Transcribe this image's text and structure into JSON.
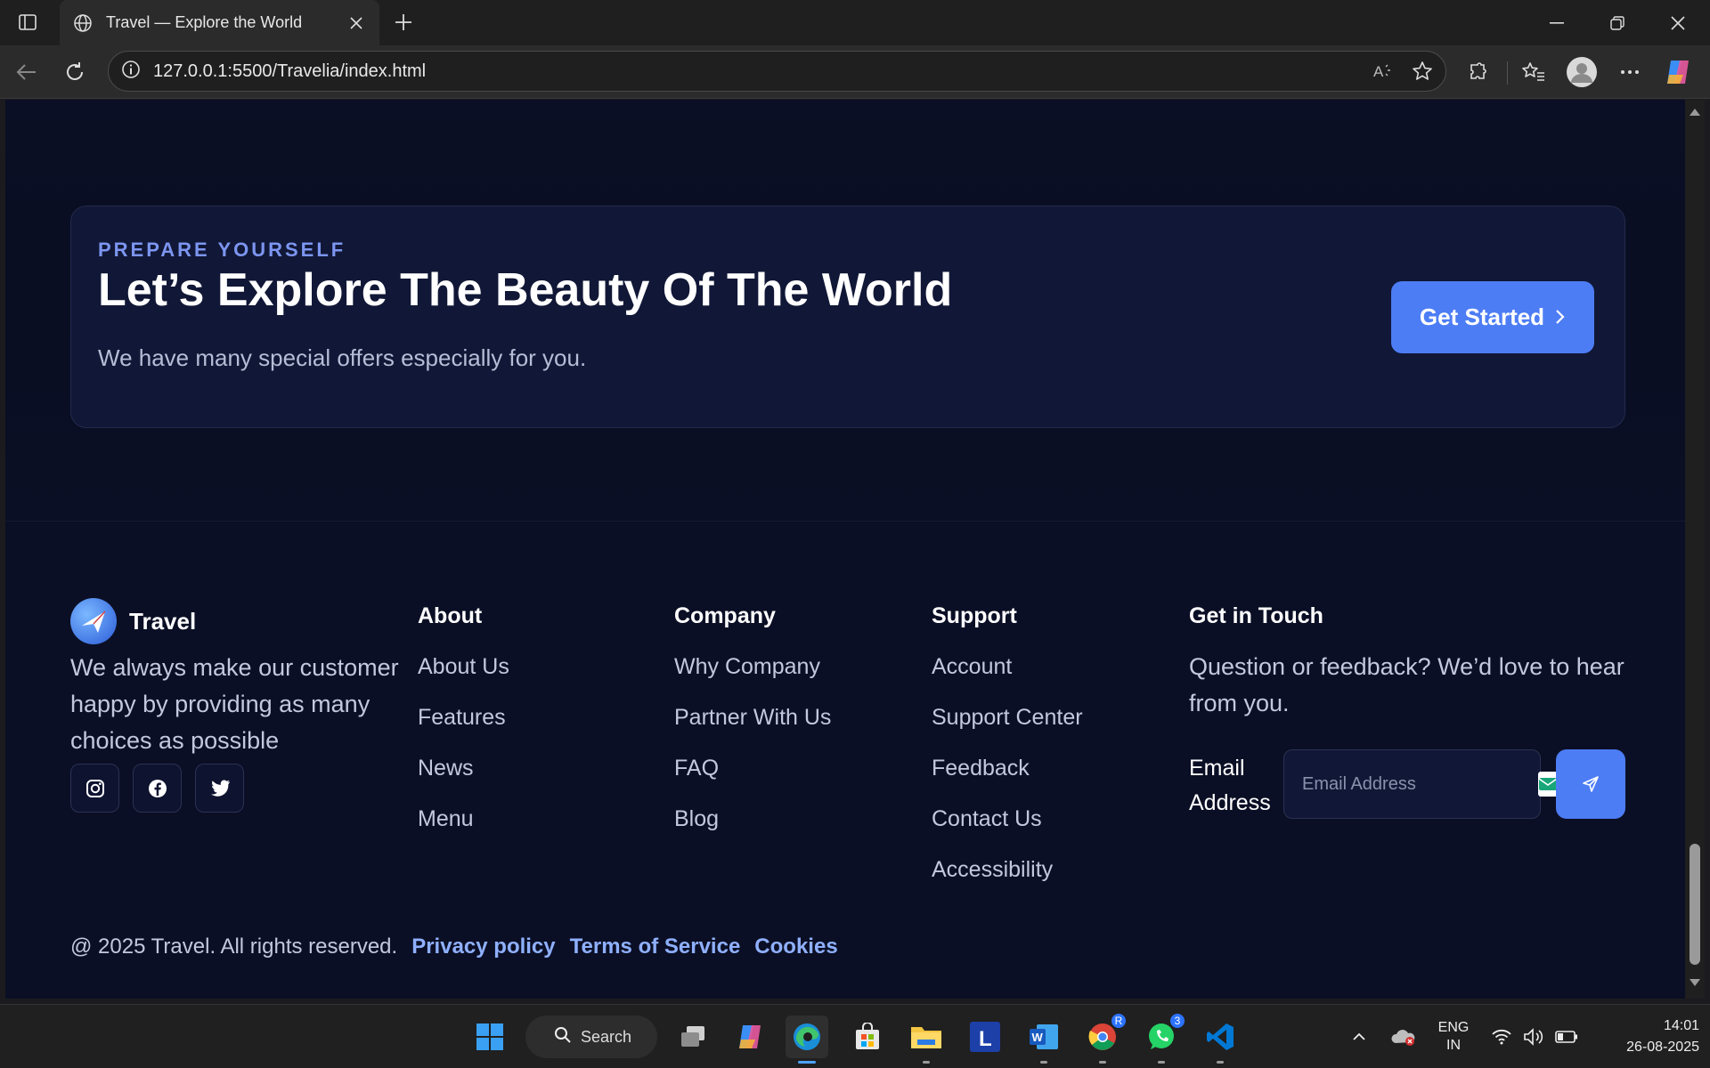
{
  "browser": {
    "tab_title": "Travel — Explore the World",
    "url": "127.0.0.1:5500/Travelia/index.html"
  },
  "cta": {
    "eyebrow": "PREPARE YOURSELF",
    "headline": "Let’s Explore The Beauty Of The World",
    "subtext": "We have many special offers especially for you.",
    "button_label": "Get Started"
  },
  "footer": {
    "brand_name": "Travel",
    "tagline": "We always make our customer happy by providing as many choices as possible",
    "socials": [
      "instagram-icon",
      "facebook-icon",
      "twitter-icon"
    ],
    "columns": [
      {
        "title": "About",
        "links": [
          "About Us",
          "Features",
          "News",
          "Menu"
        ]
      },
      {
        "title": "Company",
        "links": [
          "Why Company",
          "Partner With Us",
          "FAQ",
          "Blog"
        ]
      },
      {
        "title": "Support",
        "links": [
          "Account",
          "Support Center",
          "Feedback",
          "Contact Us",
          "Accessibility"
        ]
      }
    ],
    "get_in_touch": {
      "title": "Get in Touch",
      "lead": "Question or feedback? We’d love to hear from you.",
      "email_label": "Email Address",
      "email_placeholder": "Email Address"
    },
    "copyright": "@ 2025 Travel. All rights reserved.",
    "legal_links": [
      "Privacy policy",
      "Terms of Service",
      "Cookies"
    ]
  },
  "taskbar": {
    "search_label": "Search",
    "whatsapp_badge": "3",
    "chrome_badge": "R",
    "lang_top": "ENG",
    "lang_bottom": "IN",
    "time": "14:01",
    "date": "26-08-2025"
  },
  "colors": {
    "page_bg": "#0b0f25",
    "card_bg": "#111736",
    "accent": "#4d7df5",
    "eyebrow": "#7c95f0",
    "link": "#8fb0ff"
  }
}
